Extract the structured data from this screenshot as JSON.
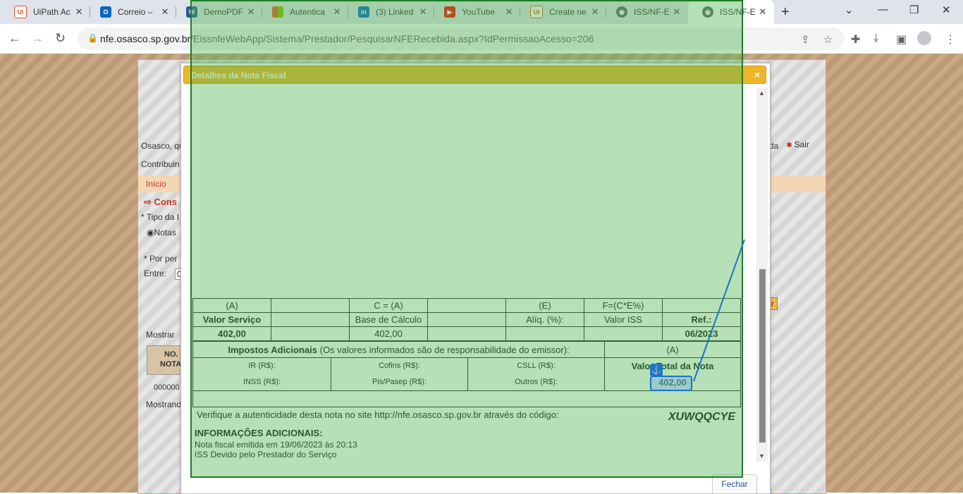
{
  "tabs": [
    {
      "title": "UiPath Ac",
      "icon": "uipath-icon",
      "color": "#e5532d"
    },
    {
      "title": "Correio –",
      "icon": "outlook-icon",
      "color": "#0a64c2"
    },
    {
      "title": "DemoPDF",
      "icon": "word-icon",
      "color": "#2b579a"
    },
    {
      "title": "Autentica",
      "icon": "microsoft-icon",
      "color": "#f25022"
    },
    {
      "title": "(3) Linked",
      "icon": "linkedin-icon",
      "color": "#0a66c2"
    },
    {
      "title": "YouTube",
      "icon": "youtube-icon",
      "color": "#ff0000"
    },
    {
      "title": "Create ne",
      "icon": "uipath-icon",
      "color": "#e5532d"
    },
    {
      "title": "ISS/NF-E",
      "icon": "globe-icon",
      "color": "#5f6368"
    },
    {
      "title": "ISS/NF-E",
      "icon": "globe-icon",
      "color": "#5f6368",
      "active": true
    }
  ],
  "address": {
    "domain": "nfe.osasco.sp.gov.br",
    "path": "/EissnfeWebApp/Sistema/Prestador/PesquisarNFERecebida.aspx?IdPermissaoAcesso=206"
  },
  "background_page": {
    "osasco_text": "Osasco, qu",
    "contribuinte": "Contribuin",
    "inicio": "Início",
    "consulta": "Cons",
    "tipo": "* Tipo da I",
    "notas": "Notas",
    "por_periodo": "* Por per",
    "entre": "Entre:",
    "entre_value": "0",
    "mostrar": "Mostrar",
    "no_label": "NO.",
    "nota_label": "NOTA",
    "row_value": "000000",
    "mostrando": "Mostrand",
    "ajuda": "da",
    "sair": "Sair",
    "btn_right": "r"
  },
  "modal": {
    "title": "Detalhes da Nota Fiscal",
    "close": "×",
    "fechar": "Fechar"
  },
  "invoice": {
    "header_row": [
      "(A)",
      "",
      "C = (A)",
      "",
      "(E)",
      "F=(C*E%)",
      ""
    ],
    "label_row": [
      "Valor Serviço",
      "",
      "Base de Cálculo",
      "",
      "Alíq. (%):",
      "Valor ISS",
      "Ref.:"
    ],
    "value_row": [
      "402,00",
      "",
      "402,00",
      "",
      "",
      "",
      "06/2023"
    ],
    "impostos_label": "Impostos Adicionais",
    "impostos_note": "(Os valores informados são de responsabilidade do emissor):",
    "total_header": "(A)",
    "ir": "IR (R$):",
    "inss": "INSS (R$):",
    "cofins": "Cofins (R$):",
    "pis": "Pis/Pasep (R$):",
    "csll": "CSLL (R$):",
    "outros": "Outros (R$):",
    "total_label": "Valor Total da Nota",
    "total_value": "402,00",
    "verify_text": "Verifique a autenticidade desta nota no site http://nfe.osasco.sp.gov.br através do código:",
    "verify_code": "XUWQQCYE",
    "info_title": "INFORMAÇÕES ADICIONAIS:",
    "info_lines": [
      "Nota fiscal emitida em 19/06/2023 às 20:13",
      "ISS Devido pelo Prestador do Serviço"
    ]
  }
}
